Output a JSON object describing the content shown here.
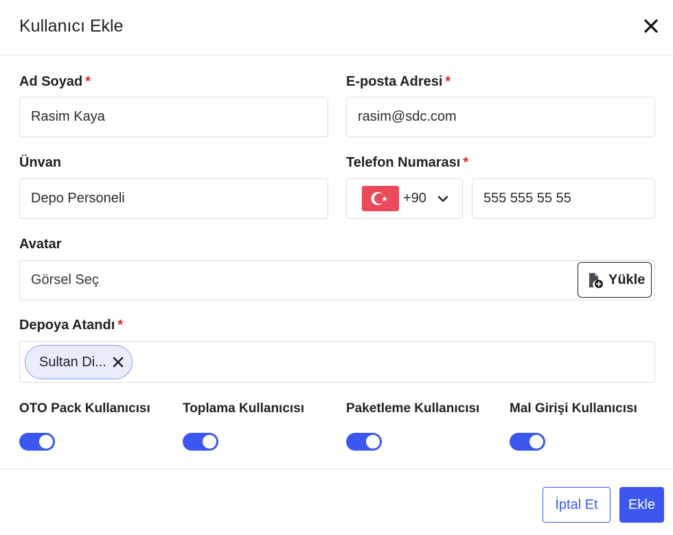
{
  "modal": {
    "title": "Kullanıcı Ekle",
    "close_icon": "close-icon"
  },
  "form": {
    "full_name": {
      "label": "Ad Soyad",
      "required_mark": "*",
      "value": "Rasim Kaya"
    },
    "email": {
      "label": "E-posta Adresi",
      "required_mark": "*",
      "value": "rasim@sdc.com"
    },
    "title_field": {
      "label": "Ünvan",
      "value": "Depo Personeli"
    },
    "phone": {
      "label": "Telefon Numarası",
      "required_mark": "*",
      "country_flag_icon": "turkey-flag-icon",
      "dial_code": "+90",
      "chevron_icon": "chevron-down-icon",
      "number": "555 555 55 55"
    },
    "avatar": {
      "label": "Avatar",
      "placeholder": "Görsel Seç",
      "upload_icon": "file-upload-icon",
      "upload_label": "Yükle"
    },
    "warehouse": {
      "label": "Depoya Atandı",
      "required_mark": "*",
      "chips": [
        {
          "label": "Sultan Di...",
          "remove_icon": "close-icon"
        }
      ]
    },
    "toggles": [
      {
        "label": "OTO Pack Kullanıcısı",
        "on": true
      },
      {
        "label": "Toplama Kullanıcısı",
        "on": true
      },
      {
        "label": "Paketleme Kullanıcısı",
        "on": true
      },
      {
        "label": "Mal Girişi Kullanıcısı",
        "on": true
      }
    ]
  },
  "footer": {
    "cancel_label": "İptal Et",
    "add_label": "Ekle"
  },
  "colors": {
    "accent": "#3b57f0",
    "required": "#e0202a",
    "chip_bg": "#e9ecfb",
    "border": "#dcdde2"
  }
}
